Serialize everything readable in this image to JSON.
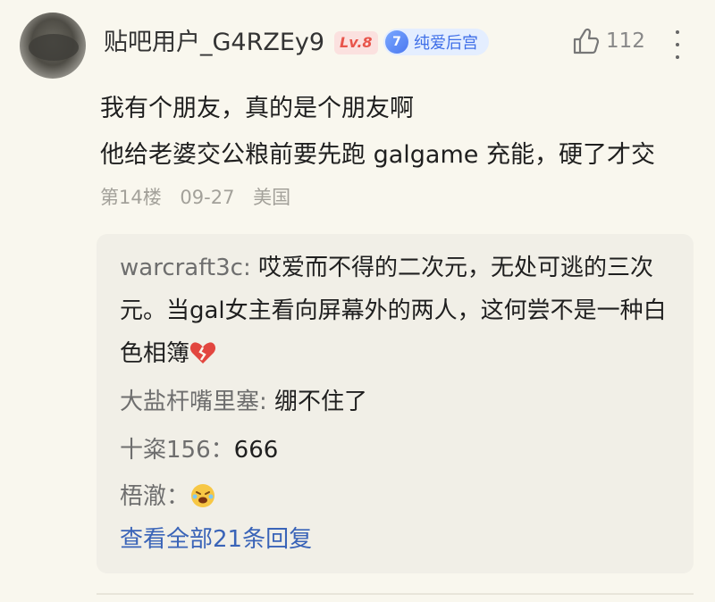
{
  "post": {
    "username": "贴吧用户_G4RZEy9",
    "level_badge": "Lv.8",
    "tag_level": "7",
    "tag_text": "纯爱后宫",
    "like_count": "112",
    "lines": [
      "我有个朋友，真的是个朋友啊",
      "他给老婆交公粮前要先跑 galgame 充能，硬了才交"
    ],
    "floor": "第14楼",
    "date": "09-27",
    "location": "美国"
  },
  "replies": [
    {
      "name": "warcraft3c",
      "sep": ": ",
      "text": "哎爱而不得的二次元，无处可逃的三次元。当gal女主看向屏幕外的两人，这何尝不是一种白色相簿",
      "emoji": "broken-heart-emoji"
    },
    {
      "name": "大盐杆嘴里塞",
      "sep": ": ",
      "text": "绷不住了"
    },
    {
      "name": "十粢156",
      "sep": "：",
      "text": "666"
    },
    {
      "name": "梧澈",
      "sep": "：",
      "text": "",
      "emoji": "tearful-laugh-emoji"
    }
  ],
  "view_all": "查看全部21条回复",
  "icons": {
    "like": "thumbs-up-icon",
    "more": "more-vertical-icon"
  },
  "colors": {
    "background": "#f9f7ee",
    "reply_box": "#f1efe7",
    "link": "#3a64b8",
    "level_badge": "#e8554b",
    "tag": "#3f6fe8"
  }
}
